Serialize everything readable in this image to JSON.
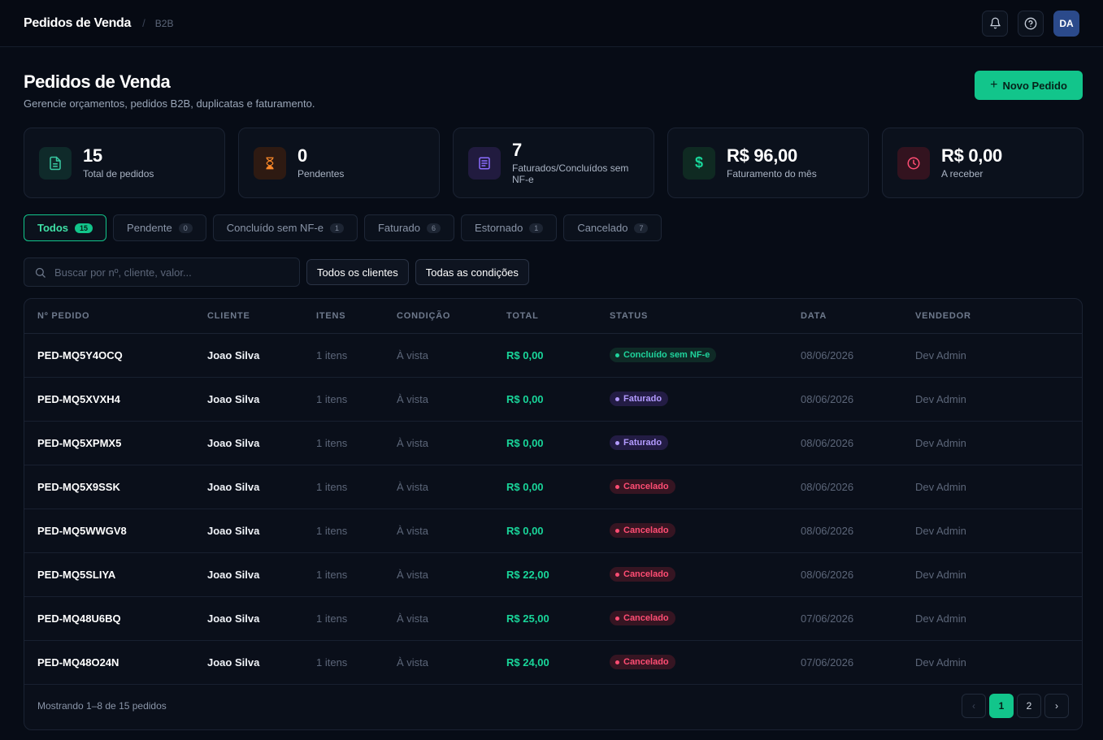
{
  "topbar": {
    "title": "Pedidos de Venda",
    "separator": "/",
    "breadcrumb": "B2B",
    "avatar_initials": "DA"
  },
  "header": {
    "title": "Pedidos de Venda",
    "subtitle": "Gerencie orçamentos, pedidos B2B, duplicatas e faturamento.",
    "new_button": "Novo Pedido"
  },
  "kpis": [
    {
      "value": "15",
      "label": "Total de pedidos",
      "icon": "document-icon",
      "color": "#38c9a2"
    },
    {
      "value": "0",
      "label": "Pendentes",
      "icon": "hourglass-icon",
      "color": "#ff8a2a"
    },
    {
      "value": "7",
      "label": "Faturados/Concluídos sem NF-e",
      "icon": "receipt-icon",
      "color": "#8b6cff"
    },
    {
      "value": "R$ 96,00",
      "label": "Faturamento do mês",
      "icon": "dollar-icon",
      "color": "#19d69a"
    },
    {
      "value": "R$ 0,00",
      "label": "A receber",
      "icon": "clock-icon",
      "color": "#ff4d73"
    }
  ],
  "tabs": [
    {
      "label": "Todos",
      "count": "15"
    },
    {
      "label": "Pendente",
      "count": "0"
    },
    {
      "label": "Concluído sem NF-e",
      "count": "1"
    },
    {
      "label": "Faturado",
      "count": "6"
    },
    {
      "label": "Estornado",
      "count": "1"
    },
    {
      "label": "Cancelado",
      "count": "7"
    }
  ],
  "filters": {
    "search_placeholder": "Buscar por nº, cliente, valor...",
    "clients": "Todos os clientes",
    "conditions": "Todas as condições"
  },
  "table": {
    "headers": [
      "Nº PEDIDO",
      "CLIENTE",
      "ITENS",
      "CONDIÇÃO",
      "TOTAL",
      "STATUS",
      "DATA",
      "VENDEDOR"
    ],
    "rows": [
      {
        "id": "PED-MQ5Y4OCQ",
        "client": "Joao Silva",
        "items": "1 itens",
        "condition": "À vista",
        "total": "R$ 0,00",
        "status": "Concluído sem NF-e",
        "status_kind": "concluido",
        "date": "08/06/2026",
        "seller": "Dev Admin"
      },
      {
        "id": "PED-MQ5XVXH4",
        "client": "Joao Silva",
        "items": "1 itens",
        "condition": "À vista",
        "total": "R$ 0,00",
        "status": "Faturado",
        "status_kind": "faturado",
        "date": "08/06/2026",
        "seller": "Dev Admin"
      },
      {
        "id": "PED-MQ5XPMX5",
        "client": "Joao Silva",
        "items": "1 itens",
        "condition": "À vista",
        "total": "R$ 0,00",
        "status": "Faturado",
        "status_kind": "faturado",
        "date": "08/06/2026",
        "seller": "Dev Admin"
      },
      {
        "id": "PED-MQ5X9SSK",
        "client": "Joao Silva",
        "items": "1 itens",
        "condition": "À vista",
        "total": "R$ 0,00",
        "status": "Cancelado",
        "status_kind": "cancelado",
        "date": "08/06/2026",
        "seller": "Dev Admin"
      },
      {
        "id": "PED-MQ5WWGV8",
        "client": "Joao Silva",
        "items": "1 itens",
        "condition": "À vista",
        "total": "R$ 0,00",
        "status": "Cancelado",
        "status_kind": "cancelado",
        "date": "08/06/2026",
        "seller": "Dev Admin"
      },
      {
        "id": "PED-MQ5SLIYA",
        "client": "Joao Silva",
        "items": "1 itens",
        "condition": "À vista",
        "total": "R$ 22,00",
        "status": "Cancelado",
        "status_kind": "cancelado",
        "date": "08/06/2026",
        "seller": "Dev Admin"
      },
      {
        "id": "PED-MQ48U6BQ",
        "client": "Joao Silva",
        "items": "1 itens",
        "condition": "À vista",
        "total": "R$ 25,00",
        "status": "Cancelado",
        "status_kind": "cancelado",
        "date": "07/06/2026",
        "seller": "Dev Admin"
      },
      {
        "id": "PED-MQ48O24N",
        "client": "Joao Silva",
        "items": "1 itens",
        "condition": "À vista",
        "total": "R$ 24,00",
        "status": "Cancelado",
        "status_kind": "cancelado",
        "date": "07/06/2026",
        "seller": "Dev Admin"
      }
    ]
  },
  "footer": {
    "info": "Mostrando 1–8 de 15 pedidos",
    "pages": [
      "1",
      "2"
    ],
    "prev": "‹",
    "next": "›"
  }
}
